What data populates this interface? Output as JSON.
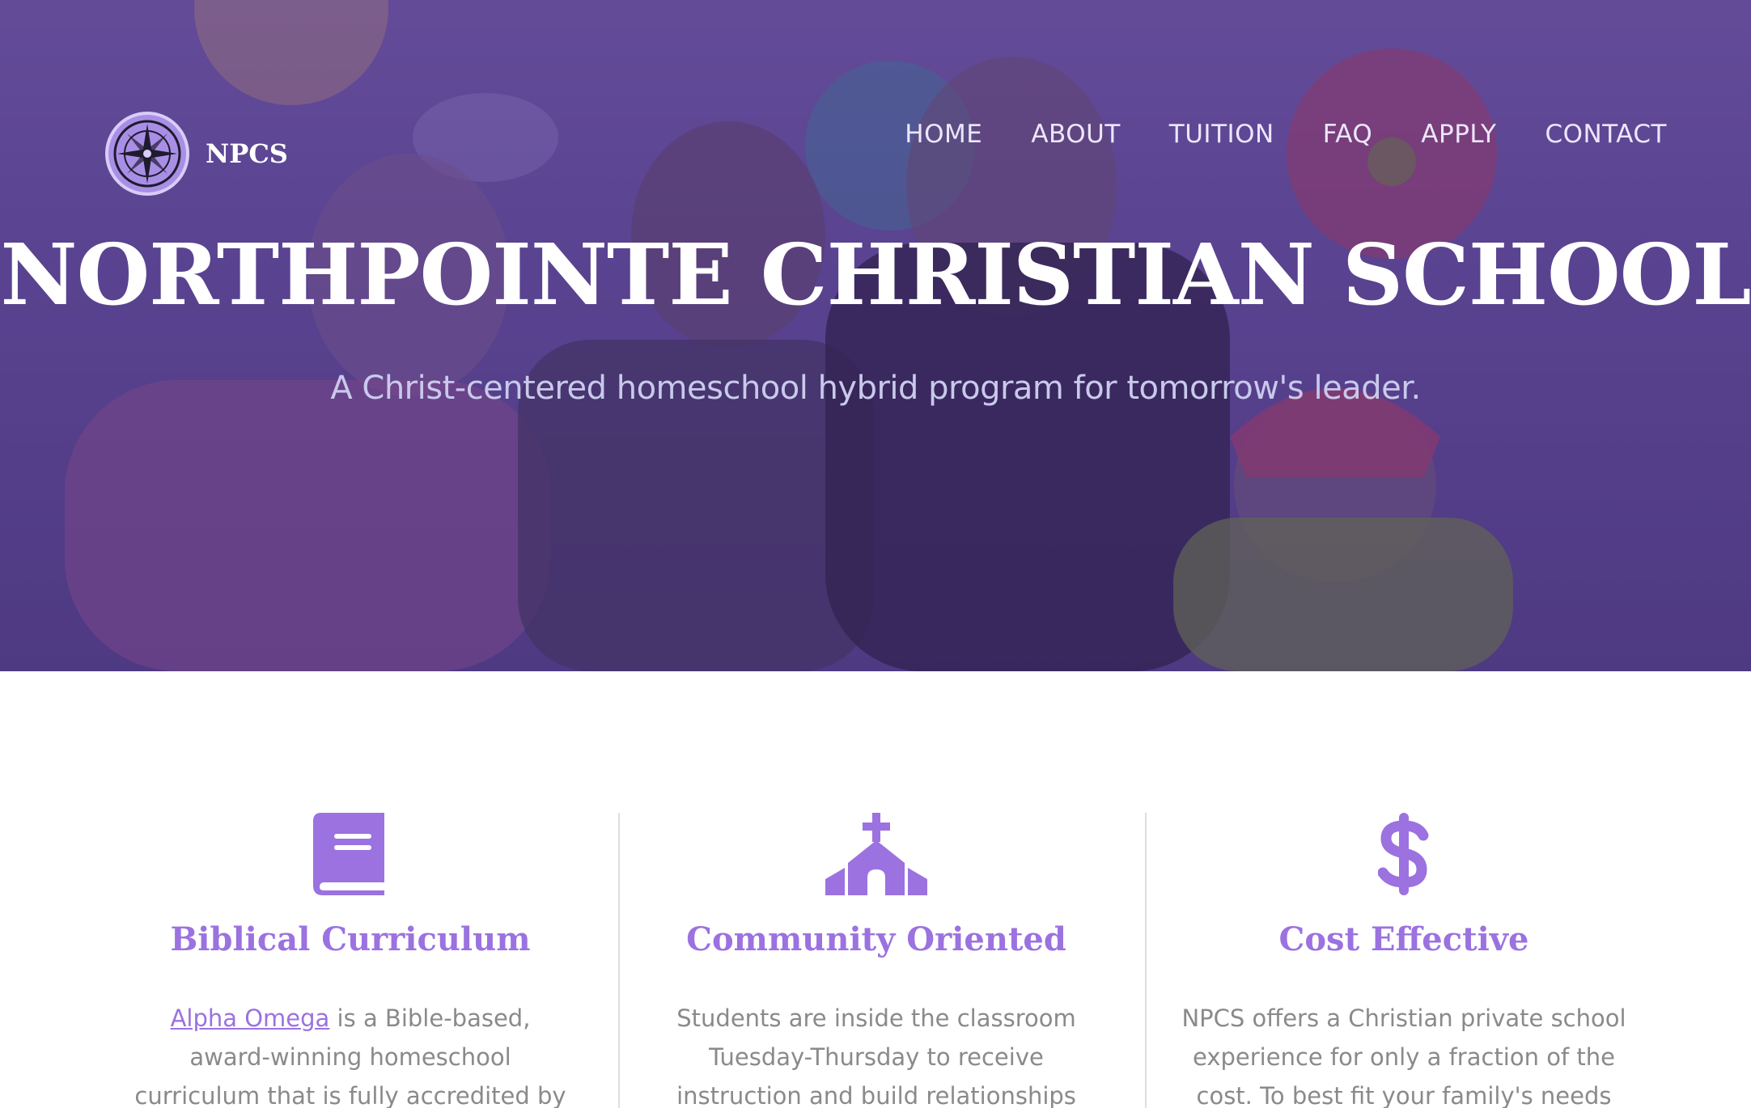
{
  "header": {
    "logo_text": "NPCS",
    "nav": [
      "HOME",
      "ABOUT",
      "TUITION",
      "FAQ",
      "APPLY",
      "CONTACT"
    ]
  },
  "hero": {
    "title": "NORTHPOINTE CHRISTIAN SCHOOL",
    "subtitle": "A Christ-centered homeschool hybrid program for tomorrow's leader."
  },
  "features": [
    {
      "icon": "book-icon",
      "title": "Biblical Curriculum",
      "link_text": "Alpha Omega",
      "text": " is a Bible-based, award-winning homeschool curriculum that is fully accredited by the State of Texas."
    },
    {
      "icon": "church-icon",
      "title": "Community Oriented",
      "text": "Students are inside the classroom Tuesday-Thursday to receive instruction and build relationships with"
    },
    {
      "icon": "dollar-icon",
      "title": "Cost Effective",
      "text": "NPCS offers a Christian private school experience for only a fraction of the cost. To best fit your family's needs we"
    }
  ],
  "colors": {
    "accent": "#9b72e0",
    "hero_overlay": "#5f4a92",
    "body_text": "#8a8a8a"
  }
}
